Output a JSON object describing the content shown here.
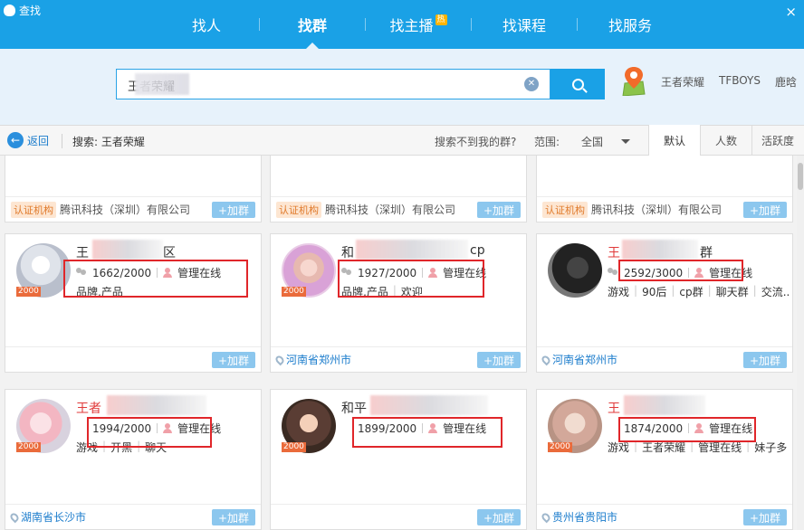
{
  "window": {
    "title": "查找",
    "close": "×"
  },
  "nav": {
    "tabs": [
      {
        "label": "找人"
      },
      {
        "label": "找群"
      },
      {
        "label": "找主播",
        "badge": "热"
      },
      {
        "label": "找课程"
      },
      {
        "label": "找服务"
      }
    ],
    "active_index": 1
  },
  "search": {
    "query": "王者荣耀",
    "hot_words": [
      "王者荣耀",
      "TFBOYS",
      "鹿晗"
    ]
  },
  "toolbar": {
    "back": "返回",
    "search_label": "搜索: 王者荣耀",
    "not_found": "搜索不到我的群?",
    "range_label": "范围:",
    "range_value": "全国",
    "sort_tabs": [
      "默认",
      "人数",
      "活跃度"
    ],
    "sort_active": 0
  },
  "top_cards": [
    {
      "cert": "认证机构",
      "company": "腾讯科技（深圳）有限公司",
      "join": "+加群"
    },
    {
      "cert": "认证机构",
      "company": "腾讯科技（深圳）有限公司",
      "join": "+加群"
    },
    {
      "cert": "认证机构",
      "company": "腾讯科技（深圳）有限公司",
      "join": "+加群"
    }
  ],
  "groups": [
    {
      "name_visible_start": "王",
      "name_visible_end": "区",
      "red": false,
      "level": "2000",
      "members": "1662/2000",
      "admin": "管理在线",
      "tags": [
        "品牌,产品"
      ],
      "location": "",
      "join": "+加群"
    },
    {
      "name_visible_start": "和",
      "name_visible_end": "cp",
      "red": false,
      "level": "2000",
      "members": "1927/2000",
      "admin": "管理在线",
      "tags": [
        "品牌,产品",
        "欢迎"
      ],
      "location": "河南省郑州市",
      "join": "+加群"
    },
    {
      "name_visible_start": "王",
      "name_visible_end": "群",
      "red": true,
      "level": "",
      "members": "2592/3000",
      "admin": "管理在线",
      "tags": [
        "游戏",
        "90后",
        "cp群",
        "聊天群",
        "交流..."
      ],
      "location": "河南省郑州市",
      "join": "+加群"
    },
    {
      "name_visible_start": "王者",
      "name_visible_end": "",
      "red": true,
      "level": "2000",
      "members": "1994/2000",
      "admin": "管理在线",
      "tags": [
        "游戏",
        "开黑",
        "聊天"
      ],
      "location": "湖南省长沙市",
      "join": "+加群"
    },
    {
      "name_visible_start": "和平",
      "name_visible_end": "",
      "red": false,
      "level": "2000",
      "members": "1899/2000",
      "admin": "管理在线",
      "tags": [],
      "location": "",
      "join": "+加群"
    },
    {
      "name_visible_start": "王",
      "name_visible_end": "",
      "red": true,
      "level": "2000",
      "members": "1874/2000",
      "admin": "管理在线",
      "tags": [
        "游戏",
        "王者荣耀",
        "管理在线",
        "妹子多"
      ],
      "location": "贵州省贵阳市",
      "join": "+加群"
    }
  ]
}
